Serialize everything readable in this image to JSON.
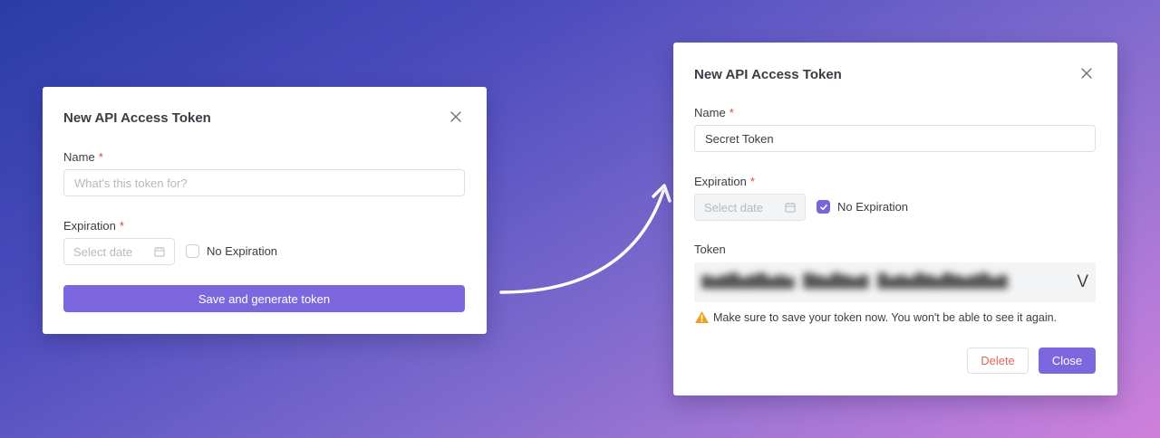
{
  "colors": {
    "accent": "#7d67de",
    "required": "#e0463b",
    "delete_text": "#e0665b",
    "warning": "#f0a020"
  },
  "dialog_new": {
    "title": "New API Access Token",
    "name_label": "Name",
    "name_required": "*",
    "name_placeholder": "What's this token for?",
    "expiration_label": "Expiration",
    "expiration_required": "*",
    "date_placeholder": "Select date",
    "no_expiration_label": "No Expiration",
    "no_expiration_checked": false,
    "submit_label": "Save and generate token",
    "icons": {
      "close": "close-icon",
      "calendar": "calendar-icon"
    }
  },
  "dialog_created": {
    "title": "New API Access Token",
    "name_label": "Name",
    "name_required": "*",
    "name_value": "Secret Token",
    "expiration_label": "Expiration",
    "expiration_required": "*",
    "date_placeholder": "Select date",
    "no_expiration_label": "No Expiration",
    "no_expiration_checked": true,
    "token_label": "Token",
    "token_end_char": "V",
    "warning_text": "Make sure to save your token now. You won't be able to see it again.",
    "delete_label": "Delete",
    "close_label": "Close",
    "icons": {
      "close": "close-icon",
      "calendar": "calendar-icon",
      "warning": "warning-icon",
      "check": "check-icon"
    }
  }
}
